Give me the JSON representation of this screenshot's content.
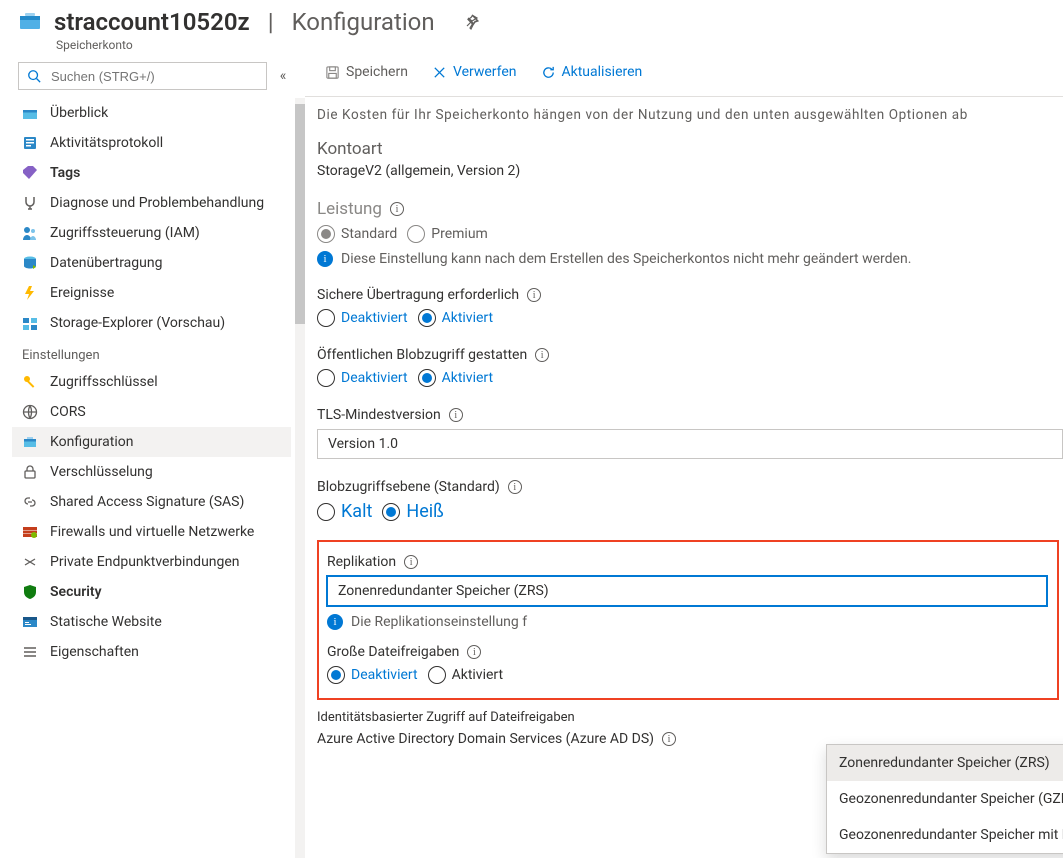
{
  "header": {
    "resource_name": "straccount10520z",
    "section": "Konfiguration",
    "subtitle": "Speicherkonto"
  },
  "search": {
    "placeholder": "Suchen (STRG+/)"
  },
  "sidebar": {
    "section_label": "Einstellungen",
    "items_top": [
      {
        "label": "Überblick"
      },
      {
        "label": "Aktivitätsprotokoll"
      },
      {
        "label": "Tags"
      },
      {
        "label": "Diagnose und Problembehandlung"
      },
      {
        "label": "Zugriffssteuerung (IAM)"
      },
      {
        "label": "Datenübertragung"
      },
      {
        "label": "Ereignisse"
      },
      {
        "label": "Storage-Explorer (Vorschau)"
      }
    ],
    "items_settings": [
      {
        "label": "Zugriffsschlüssel"
      },
      {
        "label": "CORS"
      },
      {
        "label": "Konfiguration"
      },
      {
        "label": "Verschlüsselung"
      },
      {
        "label": "Shared Access Signature (SAS)"
      },
      {
        "label": "Firewalls und virtuelle Netzwerke"
      },
      {
        "label": "Private Endpunktverbindungen"
      },
      {
        "label": "Security"
      },
      {
        "label": "Statische Website"
      },
      {
        "label": "Eigenschaften"
      }
    ]
  },
  "cmd": {
    "save": "Speichern",
    "discard": "Verwerfen",
    "refresh": "Aktualisieren"
  },
  "content": {
    "cost_info": "Die Kosten für Ihr Speicherkonto hängen von der Nutzung und den unten ausgewählten Optionen ab",
    "account_kind_label": "Kontoart",
    "account_kind_value": "StorageV2 (allgemein, Version 2)",
    "perf": {
      "label": "Leistung",
      "standard": "Standard",
      "premium": "Premium",
      "note": "Diese Einstellung kann nach dem Erstellen des Speicherkontos nicht mehr geändert werden."
    },
    "secure": {
      "label": "Sichere Übertragung erforderlich",
      "off": "Deaktiviert",
      "on": "Aktiviert"
    },
    "blobpublic": {
      "label": "Öffentlichen Blobzugriff gestatten",
      "off": "Deaktiviert",
      "on": "Aktiviert"
    },
    "tls": {
      "label": "TLS-Mindestversion",
      "value": "Version 1.0"
    },
    "tier": {
      "label": "Blobzugriffsebene (Standard)",
      "cool": "Kalt",
      "hot": "Heiß"
    },
    "replication": {
      "label": "Replikation",
      "value": "Zonenredundanter Speicher (ZRS)",
      "note_prefix": "Die Replikationseinstellung f",
      "options": [
        "Zonenredundanter Speicher (ZRS)",
        "Geozonenredundanter Speicher (GZRS)",
        "Geozonenredundanter Speicher mit Lesezugriff (RA-GZRS)"
      ]
    },
    "largefile": {
      "label": "Große Dateifreigaben",
      "off": "Deaktiviert",
      "on": "Aktiviert"
    },
    "idfs": {
      "label": "Identitätsbasierter Zugriff auf Dateifreigaben"
    },
    "aadds": {
      "label": "Azure Active Directory Domain Services (Azure AD DS)"
    }
  }
}
